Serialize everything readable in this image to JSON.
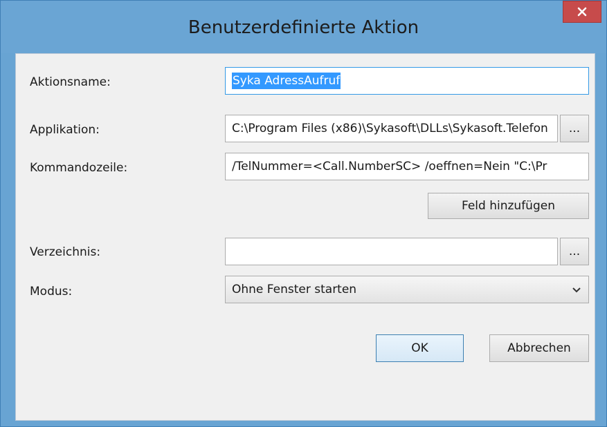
{
  "window": {
    "title": "Benutzerdefinierte Aktion"
  },
  "form": {
    "action_name": {
      "label": "Aktionsname:",
      "value": "Syka AdressAufruf"
    },
    "application": {
      "label": "Applikation:",
      "value": "C:\\Program Files (x86)\\Sykasoft\\DLLs\\Sykasoft.Telefon"
    },
    "command_line": {
      "label": "Kommandozeile:",
      "value": "/TelNummer=<Call.NumberSC> /oeffnen=Nein \"C:\\Pr"
    },
    "add_field_label": "Feld hinzufügen",
    "directory": {
      "label": "Verzeichnis:",
      "value": ""
    },
    "mode": {
      "label": "Modus:",
      "selected": "Ohne Fenster starten"
    },
    "browse_label": "..."
  },
  "buttons": {
    "ok": "OK",
    "cancel": "Abbrechen"
  },
  "colors": {
    "accent": "#3399ff",
    "close": "#c74b4b",
    "frame": "#6aa5d4"
  }
}
